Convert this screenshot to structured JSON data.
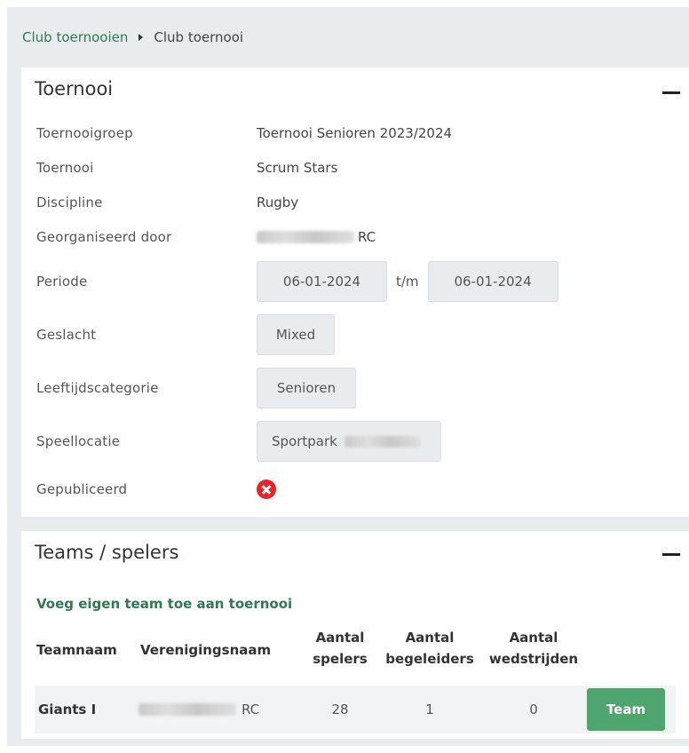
{
  "breadcrumb": {
    "parent": "Club toernooien",
    "current": "Club toernooi"
  },
  "tournament_card": {
    "title": "Toernooi",
    "fields": {
      "group_label": "Toernooigroep",
      "group_value": "Toernooi Senioren 2023/2024",
      "tournament_label": "Toernooi",
      "tournament_value": "Scrum Stars",
      "discipline_label": "Discipline",
      "discipline_value": "Rugby",
      "organizer_label": "Georganiseerd door",
      "organizer_suffix": "RC",
      "period_label": "Periode",
      "period_start": "06-01-2024",
      "period_separator": "t/m",
      "period_end": "06-01-2024",
      "gender_label": "Geslacht",
      "gender_value": "Mixed",
      "age_label": "Leeftijdscategorie",
      "age_value": "Senioren",
      "location_label": "Speellocatie",
      "location_prefix": "Sportpark",
      "published_label": "Gepubliceerd"
    }
  },
  "teams_card": {
    "title": "Teams / spelers",
    "add_link": "Voeg eigen team toe aan toernooi",
    "headers": {
      "team_name": "Teamnaam",
      "club_name": "Verenigingsnaam",
      "players_1": "Aantal",
      "players_2": "spelers",
      "staff_1": "Aantal",
      "staff_2": "begeleiders",
      "matches_1": "Aantal",
      "matches_2": "wedstrijden"
    },
    "rows": [
      {
        "team": "Giants I",
        "club_suffix": "RC",
        "players": "28",
        "staff": "1",
        "matches": "0",
        "button": "Team"
      }
    ]
  },
  "colors": {
    "accent_green": "#2f7a52",
    "button_green": "#4ea66e",
    "error_red": "#e8242b"
  },
  "icons": {
    "published_status": "x-circle-icon",
    "collapse": "minus-icon"
  }
}
